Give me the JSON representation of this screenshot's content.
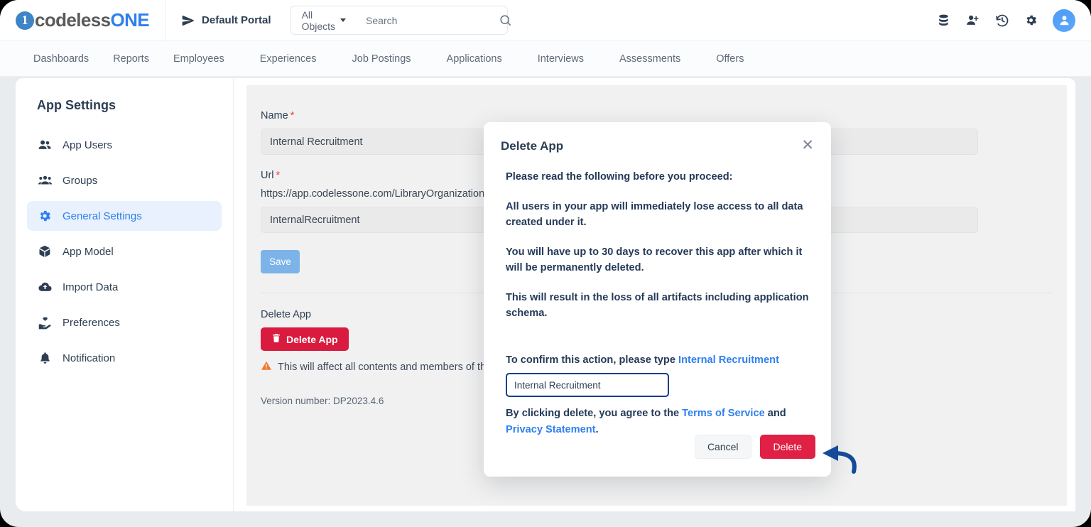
{
  "topbar": {
    "logo_mark": "1",
    "logo_text_dark": "codeless",
    "logo_text_blue": "ONE",
    "portal_label": "Default Portal",
    "portal_icon": "send-icon",
    "object_filter": "All Objects",
    "search_placeholder": "Search",
    "search_value": "",
    "icons": [
      {
        "name": "database-icon"
      },
      {
        "name": "add-user-icon"
      },
      {
        "name": "history-icon"
      },
      {
        "name": "gear-icon"
      },
      {
        "name": "user-avatar-icon"
      }
    ]
  },
  "nav": {
    "items": [
      {
        "label": "Dashboards",
        "has_caret": false
      },
      {
        "label": "Reports",
        "has_caret": false
      },
      {
        "label": "Employees",
        "has_caret": true
      },
      {
        "label": "Experiences",
        "has_caret": true
      },
      {
        "label": "Job Postings",
        "has_caret": true
      },
      {
        "label": "Applications",
        "has_caret": true
      },
      {
        "label": "Interviews",
        "has_caret": true
      },
      {
        "label": "Assessments",
        "has_caret": true
      },
      {
        "label": "Offers",
        "has_caret": true
      }
    ]
  },
  "sidebar": {
    "title": "App Settings",
    "items": [
      {
        "label": "App Users",
        "icon": "people-icon",
        "active": false
      },
      {
        "label": "Groups",
        "icon": "group-icon",
        "active": false
      },
      {
        "label": "General Settings",
        "icon": "gear-icon",
        "active": true
      },
      {
        "label": "App Model",
        "icon": "cube-icon",
        "active": false
      },
      {
        "label": "Import Data",
        "icon": "cloud-upload-icon",
        "active": false
      },
      {
        "label": "Preferences",
        "icon": "hand-heart-icon",
        "active": false
      },
      {
        "label": "Notification",
        "icon": "bell-icon",
        "active": false
      }
    ]
  },
  "form": {
    "name_label": "Name",
    "name_value": "Internal Recruitment",
    "url_label": "Url",
    "url_prefix": "https://app.codelessone.com/LibraryOrganization",
    "url_value": "InternalRecruitment",
    "save_label": "Save",
    "delete_section_label": "Delete App",
    "delete_button_label": "Delete App",
    "delete_icon": "trash-icon",
    "warning_icon": "warning-triangle-icon",
    "warning_text": "This will affect all contents and members of this app.",
    "version_text": "Version number: DP2023.4.6"
  },
  "modal": {
    "title": "Delete App",
    "close_icon": "close-icon",
    "intro": "Please read the following before you proceed:",
    "paragraphs": [
      "All users in your app will immediately lose access to all data created under it.",
      "You will have up to 30 days to recover this app after which it will be permanently deleted.",
      "This will result in the loss of all artifacts including application schema."
    ],
    "confirm_prefix": "To confirm this action, please type ",
    "confirm_app_name": "Internal Recruitment",
    "confirm_input_value": "Internal Recruitment",
    "confirm_input_placeholder": "",
    "agree_prefix": "By clicking delete, you agree to the ",
    "agree_link_1": "Terms of Service",
    "agree_middle": " and ",
    "agree_link_2": "Privacy Statement",
    "agree_suffix": ".",
    "cancel_label": "Cancel",
    "delete_label": "Delete"
  },
  "annotation": {
    "arrow": "curved-arrow-pointing-to-delete-button",
    "color": "#14499b"
  },
  "colors": {
    "accent_blue": "#2f80ed",
    "danger_red": "#e02044",
    "delete_app_red": "#d81b3f",
    "save_blue": "#7cb3e8",
    "text_dark": "#2d3e53",
    "sidebar_active_bg": "#e8f1fd"
  }
}
